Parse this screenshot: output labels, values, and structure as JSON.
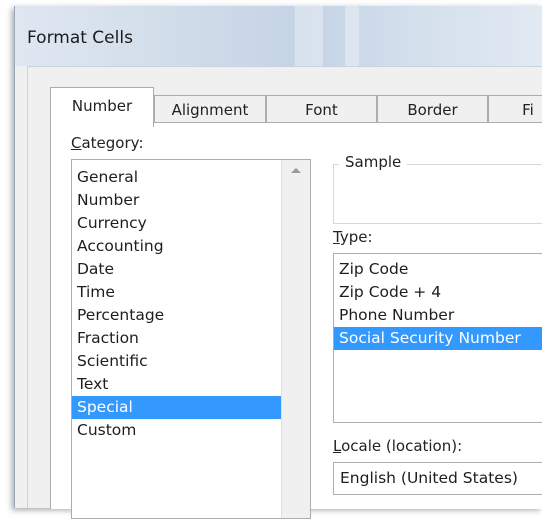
{
  "window": {
    "title": "Format Cells"
  },
  "tabs": [
    {
      "label": "Number",
      "active": true
    },
    {
      "label": "Alignment",
      "active": false
    },
    {
      "label": "Font",
      "active": false
    },
    {
      "label": "Border",
      "active": false
    },
    {
      "label": "Fi",
      "active": false
    }
  ],
  "category": {
    "label_first": "C",
    "label_rest": "ategory:",
    "items": [
      "General",
      "Number",
      "Currency",
      "Accounting",
      "Date",
      "Time",
      "Percentage",
      "Fraction",
      "Scientific",
      "Text",
      "Special",
      "Custom"
    ],
    "selected": "Special"
  },
  "sample": {
    "label": "Sample",
    "value": ""
  },
  "type": {
    "label_first": "T",
    "label_rest": "ype:",
    "items": [
      "Zip Code",
      "Zip Code + 4",
      "Phone Number",
      "Social Security Number"
    ],
    "selected": "Social Security Number"
  },
  "locale": {
    "label_first": "L",
    "label_rest": "ocale (location):",
    "value": "English (United States)"
  },
  "colors": {
    "selection": "#3399ff",
    "window_bg": "#f0f0f0"
  },
  "icons": {
    "scroll_up": "triangle-up"
  }
}
